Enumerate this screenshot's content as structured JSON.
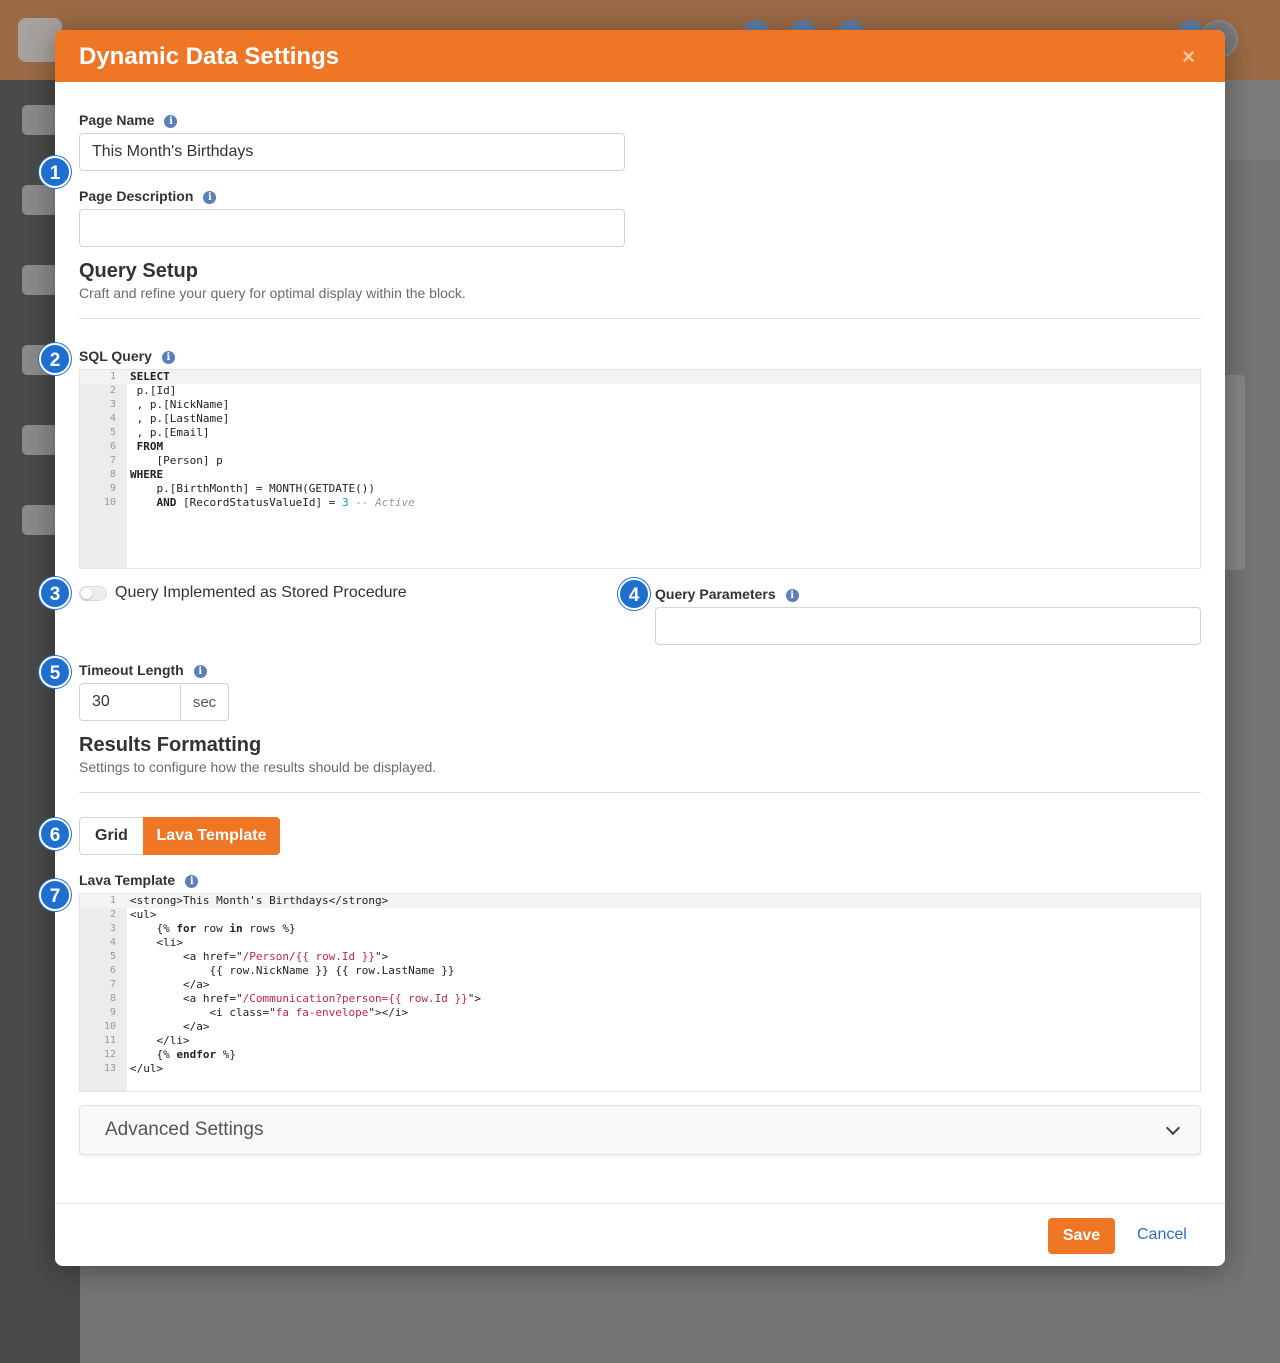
{
  "modal": {
    "title": "Dynamic Data Settings",
    "close_label": "×"
  },
  "page_name": {
    "label": "Page Name",
    "value": "This Month's Birthdays"
  },
  "page_description": {
    "label": "Page Description",
    "value": ""
  },
  "query_setup": {
    "heading": "Query Setup",
    "subtitle": "Craft and refine your query for optimal display within the block."
  },
  "sql_query": {
    "label": "SQL Query",
    "lines": [
      "SELECT",
      " p.[Id]",
      " , p.[NickName]",
      " , p.[LastName]",
      " , p.[Email]",
      " FROM",
      "    [Person] p",
      "WHERE",
      "    p.[BirthMonth] = MONTH(GETDATE())",
      "    AND [RecordStatusValueId] = 3 -- Active"
    ]
  },
  "stored_procedure": {
    "label": "Query Implemented as Stored Procedure",
    "enabled": false
  },
  "query_parameters": {
    "label": "Query Parameters",
    "value": ""
  },
  "timeout": {
    "label": "Timeout Length",
    "value": "30",
    "unit": "sec"
  },
  "results_formatting": {
    "heading": "Results Formatting",
    "subtitle": "Settings to configure how the results should be displayed.",
    "options": [
      "Grid",
      "Lava Template"
    ],
    "selected": "Lava Template"
  },
  "lava_template": {
    "label": "Lava Template",
    "lines": [
      "<strong>This Month's Birthdays</strong>",
      "<ul>",
      "    {% for row in rows %}",
      "    <li>",
      "        <a href=\"/Person/{{ row.Id }}\">",
      "            {{ row.NickName }} {{ row.LastName }}",
      "        </a>",
      "        <a href=\"/Communication?person={{ row.Id }}\">",
      "            <i class=\"fa fa-envelope\"></i>",
      "        </a>",
      "    </li>",
      "    {% endfor %}",
      "</ul>"
    ]
  },
  "advanced_settings": {
    "label": "Advanced Settings"
  },
  "footer": {
    "save_label": "Save",
    "cancel_label": "Cancel"
  },
  "badges": [
    "1",
    "2",
    "3",
    "4",
    "5",
    "6",
    "7"
  ],
  "colors": {
    "accent": "#ee7625",
    "badge": "#1f6fd0",
    "link": "#2a6fbf"
  }
}
